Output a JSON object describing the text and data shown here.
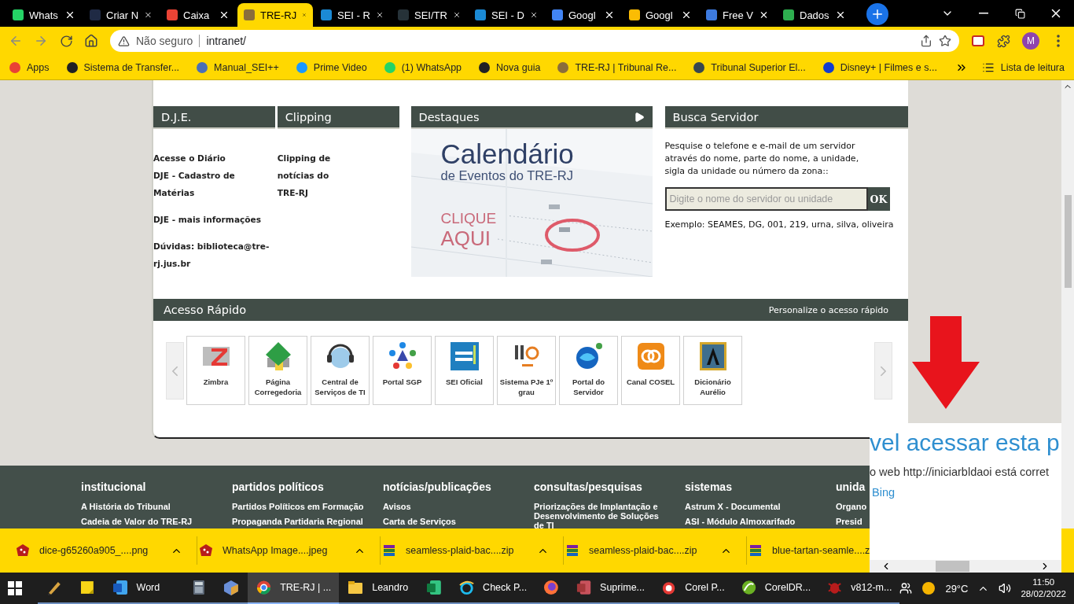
{
  "browser": {
    "tabs": [
      {
        "label": "Whats",
        "selected": false,
        "color": "#25d366"
      },
      {
        "label": "Criar N",
        "selected": false,
        "color": "#1f2a44"
      },
      {
        "label": "Caixa",
        "selected": false,
        "color": "#ea4335"
      },
      {
        "label": "TRE-RJ",
        "selected": true,
        "color": "#8a6d3b"
      },
      {
        "label": "SEI - R",
        "selected": false,
        "color": "#1b8ad5"
      },
      {
        "label": "SEI/TR",
        "selected": false,
        "color": "#263238"
      },
      {
        "label": "SEI - D",
        "selected": false,
        "color": "#1b8ad5"
      },
      {
        "label": "Googl",
        "selected": false,
        "color": "#4285f4"
      },
      {
        "label": "Googl",
        "selected": false,
        "color": "#fbbc04"
      },
      {
        "label": "Free V",
        "selected": false,
        "color": "#3d7be0"
      },
      {
        "label": "Dados",
        "selected": false,
        "color": "#2eae4f"
      }
    ],
    "security": "Não seguro",
    "url": "intranet/",
    "profile": "M",
    "bookmarks": [
      {
        "label": "Apps",
        "color": "#e94235"
      },
      {
        "label": "Sistema de Transfer...",
        "color": "#202124"
      },
      {
        "label": "Manual_SEI++",
        "color": "#4a6fb5"
      },
      {
        "label": "Prime Video",
        "color": "#1a98ff"
      },
      {
        "label": "(1) WhatsApp",
        "color": "#25d366"
      },
      {
        "label": "Nova guia",
        "color": "#202124"
      },
      {
        "label": "TRE-RJ | Tribunal Re...",
        "color": "#8a6d3b"
      },
      {
        "label": "Tribunal Superior El...",
        "color": "#37474f"
      },
      {
        "label": "Disney+ | Filmes e s...",
        "color": "#113ccf"
      }
    ],
    "reading_list": "Lista de leitura"
  },
  "page": {
    "dje": {
      "title": "D.J.E.",
      "groups": [
        [
          "Acesse o Diário",
          "DJE - Cadastro de Matérias"
        ],
        [
          "DJE - mais informações"
        ],
        [
          "Dúvidas: biblioteca@tre-rj.jus.br"
        ]
      ]
    },
    "clipping": {
      "title": "Clipping",
      "text": "Clipping de notícias do TRE-RJ"
    },
    "destaques": {
      "title": "Destaques",
      "banner_title": "Calendário",
      "banner_subtitle": "de Eventos do TRE-RJ",
      "banner_cta": [
        "CLIQUE",
        "AQUI"
      ]
    },
    "busca": {
      "title": "Busca Servidor",
      "description": "Pesquise o telefone e e-mail de um servidor através do nome, parte do nome, a unidade, sigla da unidade ou número da zona::",
      "placeholder": "Digite o nome do servidor ou unidade",
      "button": "OK",
      "example": "Exemplo: SEAMES, DG, 001, 219, urna, silva, oliveira"
    },
    "acesso": {
      "title": "Acesso Rápido",
      "personalize": "Personalize o acesso rápido",
      "tiles": [
        {
          "label": "Zimbra",
          "kind": "zimbra"
        },
        {
          "label": "Página Corregedoria",
          "kind": "corregedoria"
        },
        {
          "label": "Central de Serviços de TI",
          "kind": "central"
        },
        {
          "label": "Portal SGP",
          "kind": "sgp"
        },
        {
          "label": "SEI Oficial",
          "kind": "sei"
        },
        {
          "label": "Sistema PJe 1º grau",
          "kind": "pje"
        },
        {
          "label": "Portal do Servidor",
          "kind": "portal"
        },
        {
          "label": "Canal COSEL",
          "kind": "cosel"
        },
        {
          "label": "Dicionário Aurélio",
          "kind": "dicionario"
        }
      ]
    },
    "footer": [
      {
        "heading": "institucional",
        "links": [
          "A História do Tribunal",
          "Cadeia de Valor do TRE-RJ"
        ]
      },
      {
        "heading": "partidos políticos",
        "links": [
          "Partidos Políticos em Formação",
          "Propaganda Partidaria Regional"
        ]
      },
      {
        "heading": "notícias/publicações",
        "links": [
          "Avisos",
          "Carta de Serviços"
        ]
      },
      {
        "heading": "consultas/pesquisas",
        "links": [
          "Priorizações de Implantação e Desenvolvimento de Soluções de TI"
        ]
      },
      {
        "heading": "sistemas",
        "links": [
          "Astrum X - Documental",
          "ASI - Módulo Almoxarifado"
        ]
      },
      {
        "heading": "unida",
        "links": [
          "Organo",
          "Presid"
        ]
      }
    ]
  },
  "popup": {
    "title": "vel acessar esta p",
    "body": "o web http://iniciarbldaoi está corret",
    "link": "Bing"
  },
  "downloads": [
    {
      "name": "dice-g65260a905_....png"
    },
    {
      "name": "WhatsApp Image....jpeg"
    },
    {
      "name": "seamless-plaid-bac....zip",
      "kind": "archive"
    },
    {
      "name": "seamless-plaid-bac....zip",
      "kind": "archive"
    },
    {
      "name": "blue-tartan-seamle....z",
      "kind": "archive"
    }
  ],
  "taskbar": {
    "apps": [
      {
        "kind": "tool",
        "selected": false
      },
      {
        "kind": "notes",
        "selected": false
      },
      {
        "kind": "word",
        "label": "Word",
        "selected": false
      },
      {
        "kind": "calculator",
        "selected": false
      },
      {
        "kind": "cube",
        "selected": false
      },
      {
        "kind": "chrome",
        "label": "TRE-RJ | ...",
        "selected": true
      },
      {
        "kind": "folder",
        "label": "Leandro",
        "selected": false
      },
      {
        "kind": "excel",
        "selected": false
      },
      {
        "kind": "ie",
        "label": "Check P...",
        "selected": false
      },
      {
        "kind": "firefox",
        "selected": false
      },
      {
        "kind": "access",
        "label": "Suprime...",
        "selected": false
      },
      {
        "kind": "corelphoto",
        "label": "Corel P...",
        "selected": false
      },
      {
        "kind": "coreldraw",
        "label": "CorelDR...",
        "selected": false
      },
      {
        "kind": "bug",
        "label": "v812-m...",
        "selected": false
      }
    ],
    "temperature": "29°C",
    "time": "11:50",
    "date": "28/02/2022"
  }
}
